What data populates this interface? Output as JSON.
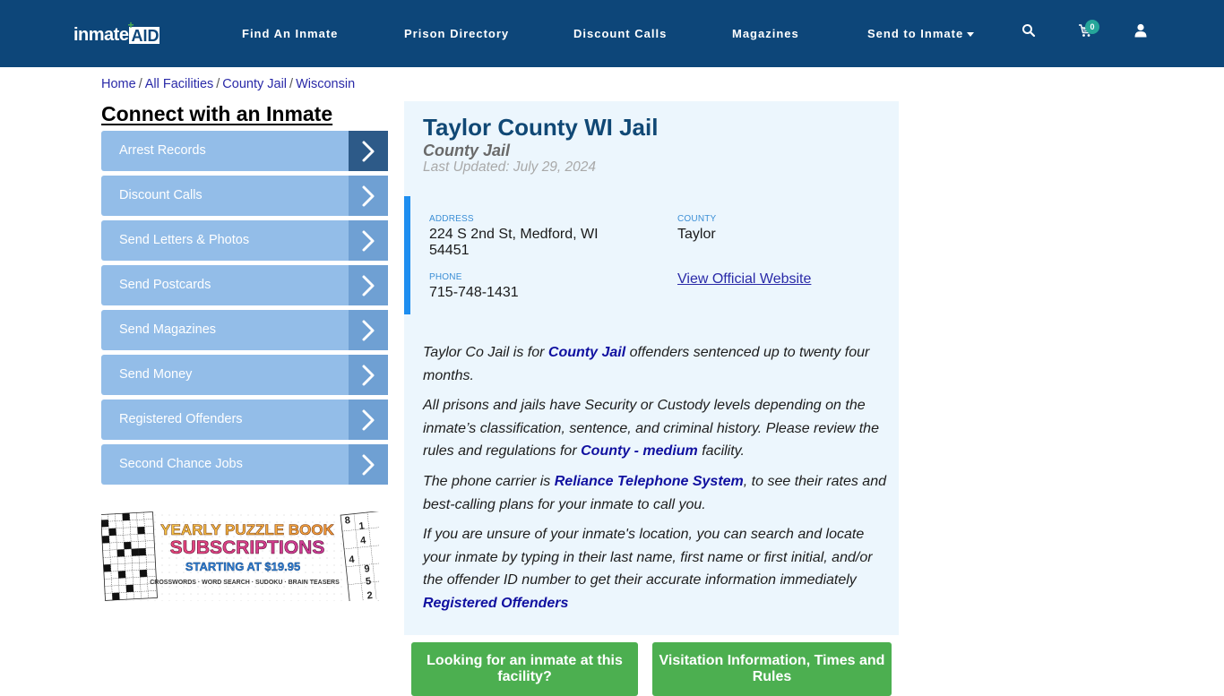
{
  "header": {
    "logo": {
      "text_main": "inmate",
      "text_accent": "AID",
      "plus": "+"
    },
    "nav": [
      {
        "label": "Find An Inmate"
      },
      {
        "label": "Prison Directory"
      },
      {
        "label": "Discount Calls"
      },
      {
        "label": "Magazines"
      },
      {
        "label": "Send to Inmate",
        "has_dropdown": true
      }
    ],
    "icons": {
      "search": "search-icon",
      "cart": "cart-icon",
      "user": "user-icon"
    },
    "cart_count": "0",
    "colors": {
      "background": "#0d4679",
      "badge": "#26a69a"
    }
  },
  "breadcrumb": [
    {
      "label": "Home"
    },
    {
      "label": "All Facilities"
    },
    {
      "label": "County Jail"
    },
    {
      "label": "Wisconsin"
    }
  ],
  "breadcrumb_separator": "/",
  "sidebar": {
    "title": "Connect with an Inmate",
    "items": [
      {
        "label": "Arrest Records",
        "active": true
      },
      {
        "label": "Discount Calls"
      },
      {
        "label": "Send Letters & Photos"
      },
      {
        "label": "Send Postcards"
      },
      {
        "label": "Send Magazines"
      },
      {
        "label": "Send Money"
      },
      {
        "label": "Registered Offenders"
      },
      {
        "label": "Second Chance Jobs"
      }
    ],
    "ad": {
      "line1": "YEARLY PUZZLE BOOK",
      "line2": "SUBSCRIPTIONS",
      "line3": "STARTING AT $19.95",
      "line4": "CROSSWORDS · WORD SEARCH · SUDOKU · BRAIN TEASERS",
      "sudoku_digits": [
        "8",
        "1",
        "4",
        "4",
        "9",
        "5",
        "2"
      ]
    }
  },
  "facility": {
    "title": "Taylor County WI Jail",
    "type": "County Jail",
    "last_updated": "Last Updated: July 29, 2024",
    "address_label": "ADDRESS",
    "address_line1": "224 S 2nd St, Medford, WI",
    "address_line2": "54451",
    "county_label": "COUNTY",
    "county": "Taylor",
    "phone_label": "PHONE",
    "phone": "715-748-1431",
    "website_link": "View Official Website"
  },
  "description": {
    "p1": {
      "before": "Taylor Co Jail is for ",
      "link": "County Jail",
      "after": " offenders sentenced up to twenty four months."
    },
    "p2": {
      "before": "All prisons and jails have Security or Custody levels depending on the inmate’s classification, sentence, and criminal history. Please review the rules and regulations for ",
      "link": "County - medium",
      "after": " facility."
    },
    "p3": {
      "before": "The phone carrier is ",
      "link": "Reliance Telephone System",
      "after": ", to see their rates and best-calling plans for your inmate to call you."
    },
    "p4": {
      "before": "If you are unsure of your inmate's location, you can search and locate your inmate by typing in their last name, first name or first initial, and/or the offender ID number to get their accurate information immediately ",
      "link": "Registered Offenders"
    }
  },
  "buttons": {
    "find_inmate": "Looking for an inmate at this facility?",
    "visitation": "Visitation Information, Times and Rules"
  }
}
